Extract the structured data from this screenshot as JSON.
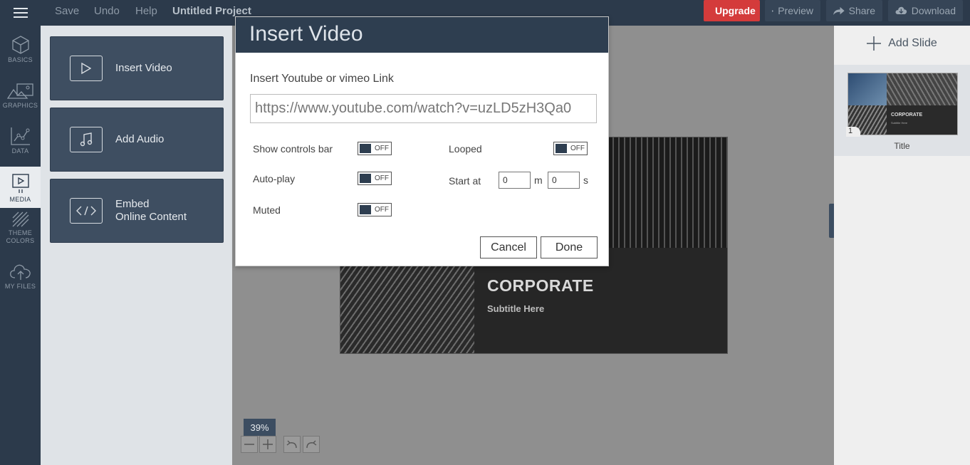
{
  "topbar": {
    "menu_icon": "hamburger-icon",
    "links": [
      "Save",
      "Undo",
      "Help"
    ],
    "project_title": "Untitled Project",
    "upgrade_label": "Upgrade",
    "preview_label": "Preview",
    "share_label": "Share",
    "download_label": "Download",
    "upgrade_color": "#d43b3b"
  },
  "rail": {
    "items": [
      {
        "label": "BASICS",
        "icon": "cube-icon"
      },
      {
        "label": "GRAPHICS",
        "icon": "image-icon"
      },
      {
        "label": "DATA",
        "icon": "chart-icon"
      },
      {
        "label": "MEDIA",
        "icon": "media-icon",
        "active": true
      },
      {
        "label": "THEME COLORS",
        "line1": "THEME",
        "line2": "COLORS",
        "icon": "pattern-icon"
      },
      {
        "label": "MY FILES",
        "icon": "cloud-upload-icon"
      }
    ]
  },
  "media_panel": {
    "cards": [
      {
        "label": "Insert Video",
        "icon": "play-icon"
      },
      {
        "label": "Add Audio",
        "icon": "music-note-icon"
      },
      {
        "line1": "Embed",
        "line2": "Online Content",
        "icon": "code-icon"
      }
    ]
  },
  "slide": {
    "title": "CORPORATE",
    "subtitle": "Subtitle Here"
  },
  "zoom": {
    "level": "39%"
  },
  "right_panel": {
    "add_slide_label": "Add Slide",
    "thumb": {
      "number": "1",
      "label": "Title",
      "title": "CORPORATE",
      "subtitle": "Subtitle Here"
    }
  },
  "modal": {
    "title": "Insert Video",
    "link_label": "Insert Youtube or vimeo Link",
    "url_value": "https://www.youtube.com/watch?v=uzLD5zH3Qa0",
    "options": {
      "show_controls": {
        "label": "Show controls bar",
        "state": "OFF"
      },
      "autoplay": {
        "label": "Auto-play",
        "state": "OFF"
      },
      "muted": {
        "label": "Muted",
        "state": "OFF"
      },
      "looped": {
        "label": "Looped",
        "state": "OFF"
      }
    },
    "start_at": {
      "label": "Start at",
      "minutes": "0",
      "minutes_unit": "m",
      "seconds": "0",
      "seconds_unit": "s"
    },
    "cancel_label": "Cancel",
    "done_label": "Done"
  }
}
